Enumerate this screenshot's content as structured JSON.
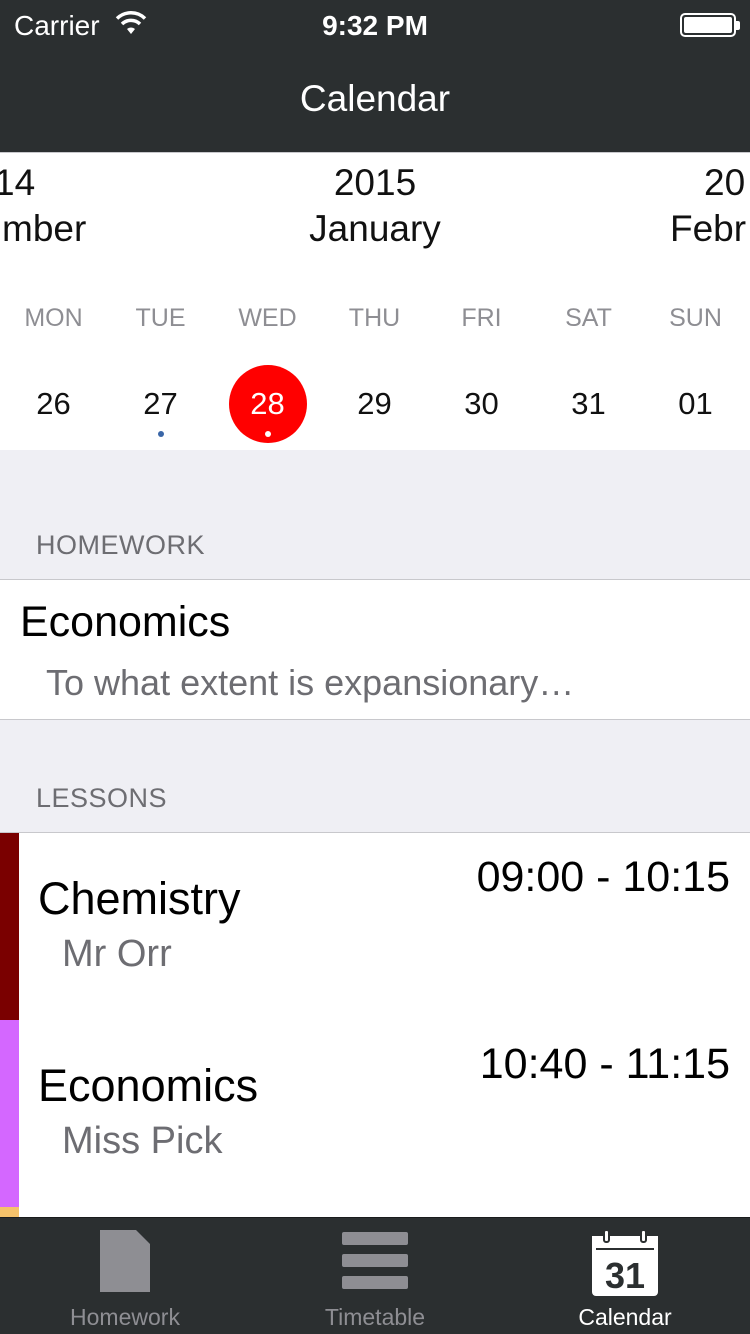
{
  "status_bar": {
    "carrier": "Carrier",
    "time": "9:32 PM"
  },
  "nav": {
    "title": "Calendar"
  },
  "months": [
    {
      "year": "14",
      "month": "mber"
    },
    {
      "year": "2015",
      "month": "January"
    },
    {
      "year": "20",
      "month": "Febr"
    }
  ],
  "weekdays": [
    "MON",
    "TUE",
    "WED",
    "THU",
    "FRI",
    "SAT",
    "SUN"
  ],
  "days": [
    "26",
    "27",
    "28",
    "29",
    "30",
    "31",
    "01"
  ],
  "selected_day": "28",
  "days_with_events": [
    "27",
    "28"
  ],
  "homework": {
    "header": "HOMEWORK",
    "items": [
      {
        "subject": "Economics",
        "description": "To what extent is expansionary…"
      }
    ]
  },
  "lessons": {
    "header": "LESSONS",
    "items": [
      {
        "subject": "Chemistry",
        "teacher": "Mr Orr",
        "time": "09:00 - 10:15",
        "color": "#7a0000"
      },
      {
        "subject": "Economics",
        "teacher": "Miss Pick",
        "time": "10:40 - 11:15",
        "color": "#d467ff"
      }
    ]
  },
  "tabs": [
    {
      "label": "Homework",
      "icon": "document-icon"
    },
    {
      "label": "Timetable",
      "icon": "list-icon"
    },
    {
      "label": "Calendar",
      "icon": "calendar-icon",
      "icon_text": "31",
      "active": true
    }
  ],
  "colors": {
    "bar_bg": "#2b2f30",
    "selected": "#ff0000",
    "event_dot": "#3a66a7"
  }
}
